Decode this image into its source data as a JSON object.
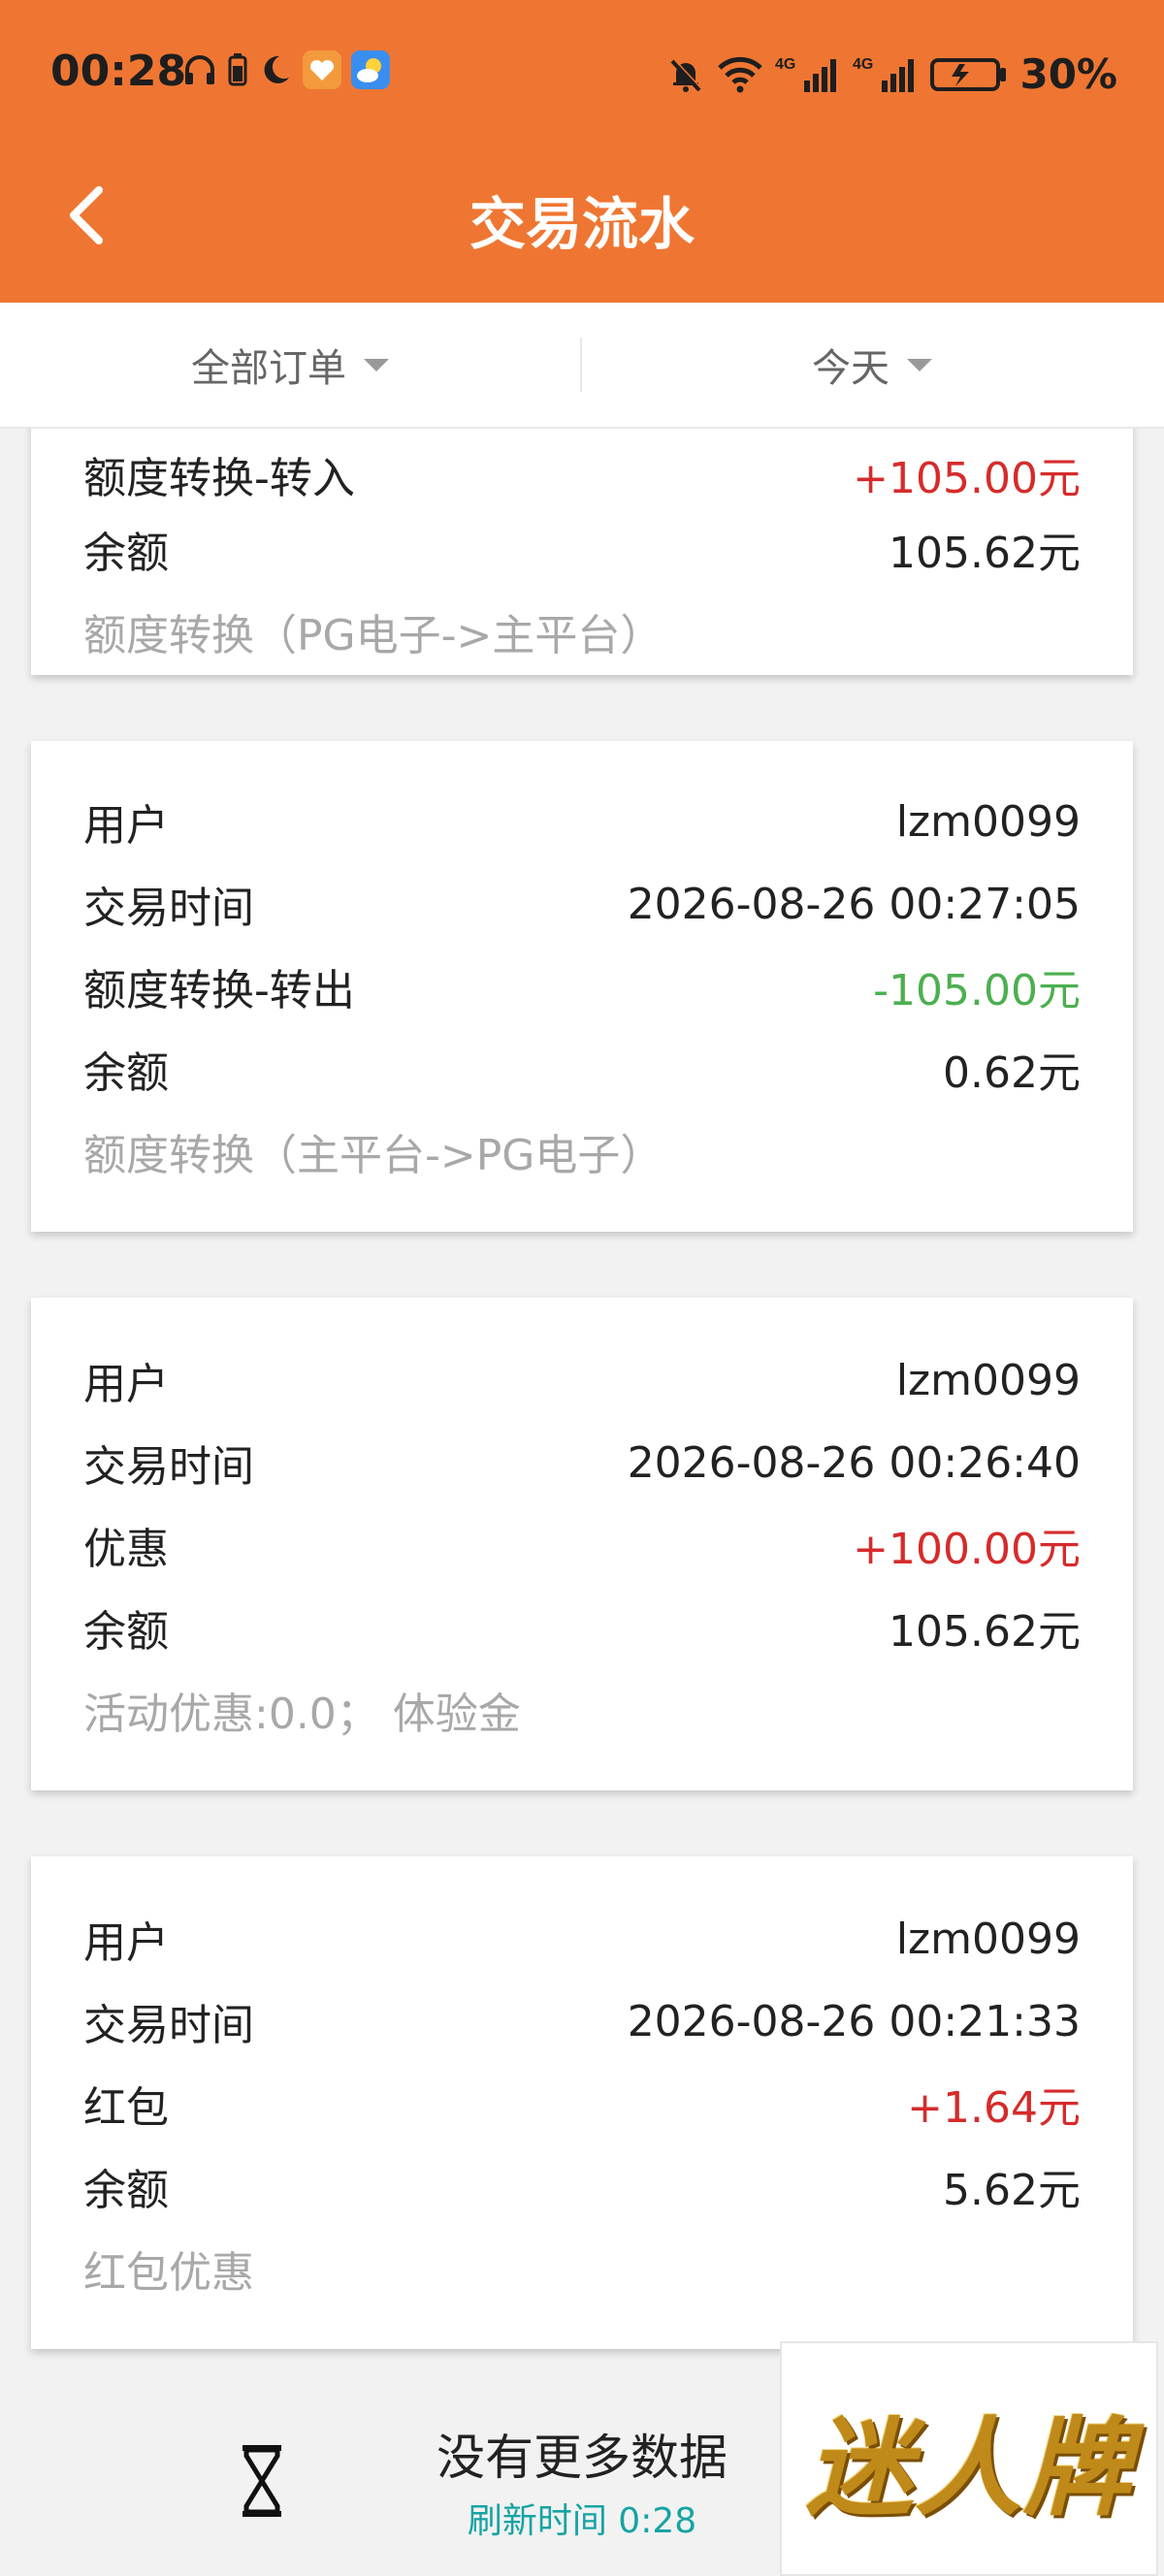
{
  "status_bar": {
    "time": "00:28",
    "battery_pct": "30%",
    "network_labels": [
      "4G",
      "4G"
    ],
    "icons_left": [
      "headphones-icon",
      "battery-small-icon",
      "moon-icon",
      "heart-app-icon",
      "weather-app-icon"
    ],
    "icons_right": [
      "mute-bell-icon",
      "wifi-icon",
      "signal-icon",
      "signal-icon",
      "battery-icon"
    ]
  },
  "header": {
    "title": "交易流水"
  },
  "filters": {
    "order_type": "全部订单",
    "date_range": "今天"
  },
  "transactions": [
    {
      "type_label": "额度转换-转入",
      "amount": "+105.00元",
      "amount_sign": "positive",
      "balance_label": "余额",
      "balance": "105.62元",
      "note": "额度转换（PG电子->主平台）"
    },
    {
      "user_label": "用户",
      "user": "lzm0099",
      "time_label": "交易时间",
      "time": "2026-08-26 00:27:05",
      "type_label": "额度转换-转出",
      "amount": "-105.00元",
      "amount_sign": "negative",
      "balance_label": "余额",
      "balance": "0.62元",
      "note": "额度转换（主平台->PG电子）"
    },
    {
      "user_label": "用户",
      "user": "lzm0099",
      "time_label": "交易时间",
      "time": "2026-08-26 00:26:40",
      "type_label": "优惠",
      "amount": "+100.00元",
      "amount_sign": "positive",
      "balance_label": "余额",
      "balance": "105.62元",
      "note": "活动优惠:0.0；  体验金"
    },
    {
      "user_label": "用户",
      "user": "lzm0099",
      "time_label": "交易时间",
      "time": "2026-08-26 00:21:33",
      "type_label": "红包",
      "amount": "+1.64元",
      "amount_sign": "positive",
      "balance_label": "余额",
      "balance": "5.62元",
      "note": "红包优惠"
    }
  ],
  "footer": {
    "no_more": "没有更多数据",
    "refresh_time": "刷新时间 0:28"
  },
  "logo": {
    "text": "迷人牌"
  },
  "colors": {
    "header": "#ef7632",
    "positive": "#d62b2b",
    "negative": "#4caf50",
    "refresh": "#16a3a3",
    "note": "#a8a8a8"
  }
}
